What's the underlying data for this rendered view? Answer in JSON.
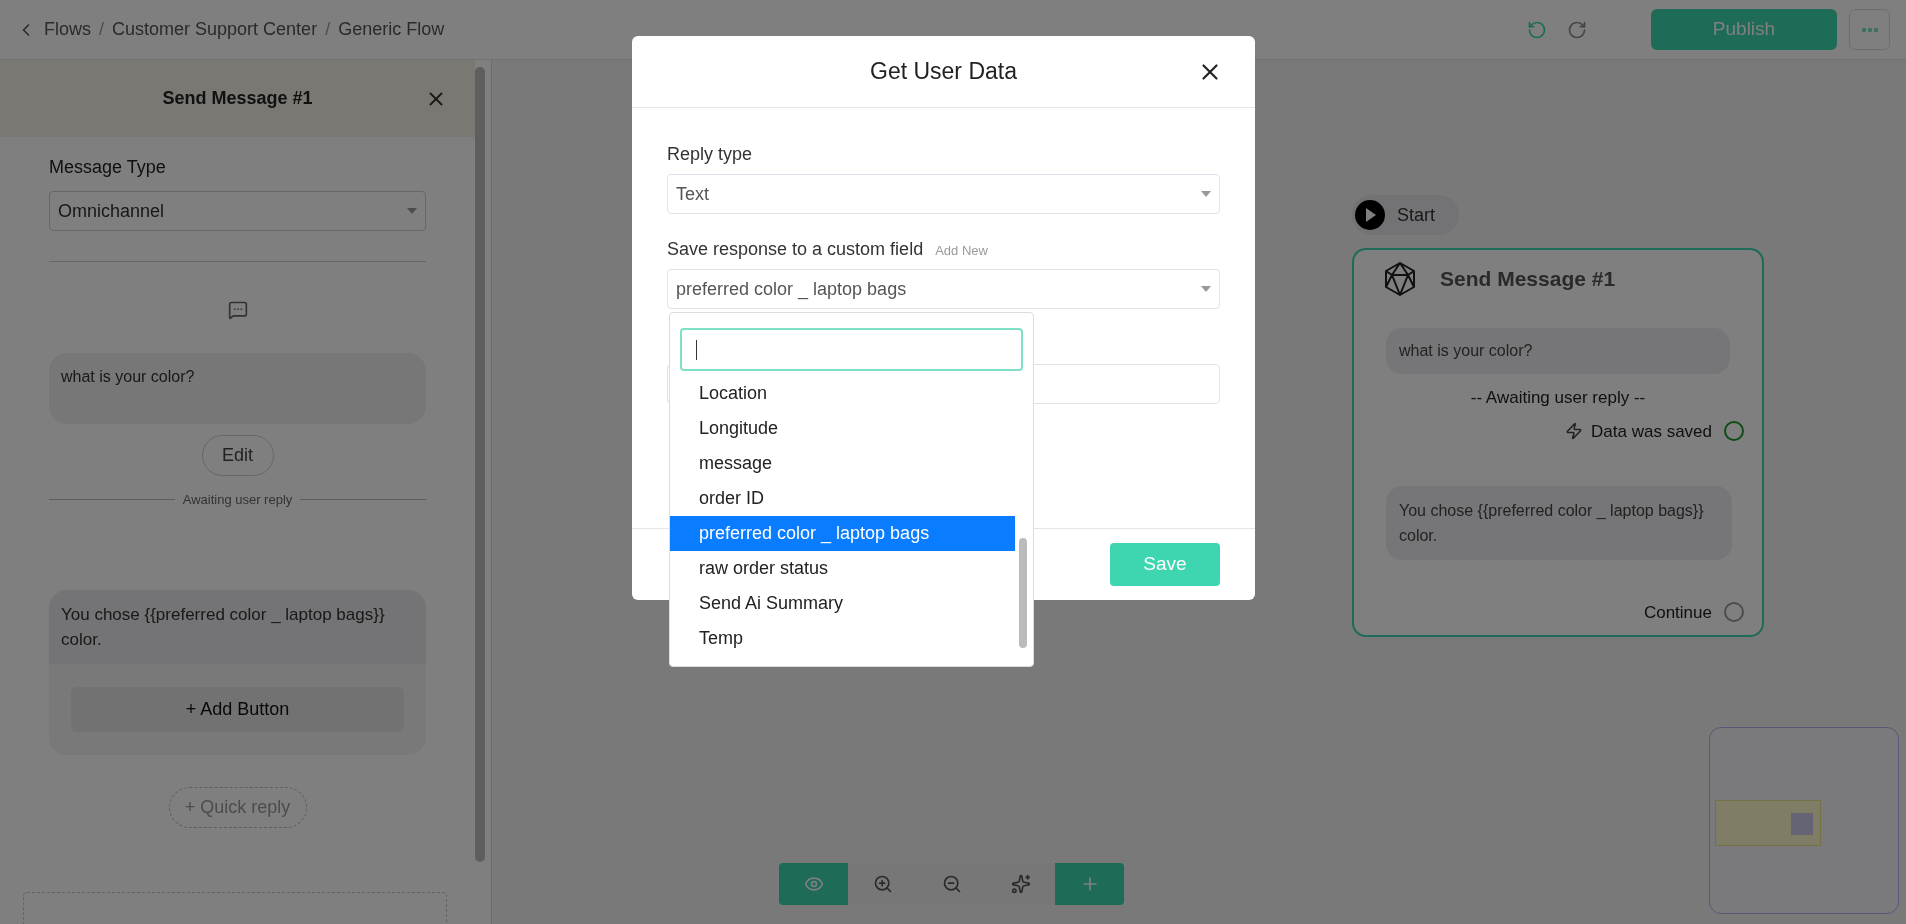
{
  "breadcrumb": [
    {
      "label": "Flows"
    },
    {
      "separator": "/",
      "label": "Customer Support Center"
    },
    {
      "separator": "/",
      "label": "Generic Flow"
    }
  ],
  "header": {
    "publish": "Publish"
  },
  "side_panel": {
    "title": "Send Message #1",
    "message_type_label": "Message Type",
    "message_type": "Omnichannel",
    "message": "what is your color?",
    "edit": "Edit",
    "divider_text": "Awaiting user reply",
    "reply_message": "You chose {{preferred color _ laptop bags}} color.",
    "add_button": "+ Add Button",
    "quick_reply": "+ Quick reply"
  },
  "canvas": {
    "start": "Start",
    "node": {
      "title": "Send Message #1",
      "message": "what is your color?",
      "awaiting": "-- Awaiting user reply --",
      "data_saved": "Data was saved",
      "reply": "You chose {{preferred color _ laptop bags}} color.",
      "continue": "Continue"
    },
    "toolbar": [
      {
        "kind": "view"
      },
      {
        "kind": "zoom_in"
      },
      {
        "kind": "zoom_out"
      },
      {
        "kind": "ai"
      },
      {
        "kind": "add"
      }
    ]
  },
  "modal": {
    "title": "Get User Data",
    "reply_type_label": "Reply type",
    "reply_type": "Text",
    "custom_field_label": "Save response to a custom field",
    "add_new": "Add New",
    "custom_field": "preferred color _ laptop bags",
    "save": "Save",
    "options": [
      {
        "label": "Location",
        "selected": false
      },
      {
        "label": "Longitude",
        "selected": false
      },
      {
        "label": "message",
        "selected": false
      },
      {
        "label": "order ID",
        "selected": false
      },
      {
        "label": "preferred color _ laptop bags",
        "selected": true
      },
      {
        "label": "raw order status",
        "selected": false
      },
      {
        "label": "Send Ai Summary",
        "selected": false
      },
      {
        "label": "Temp",
        "selected": false
      }
    ]
  }
}
